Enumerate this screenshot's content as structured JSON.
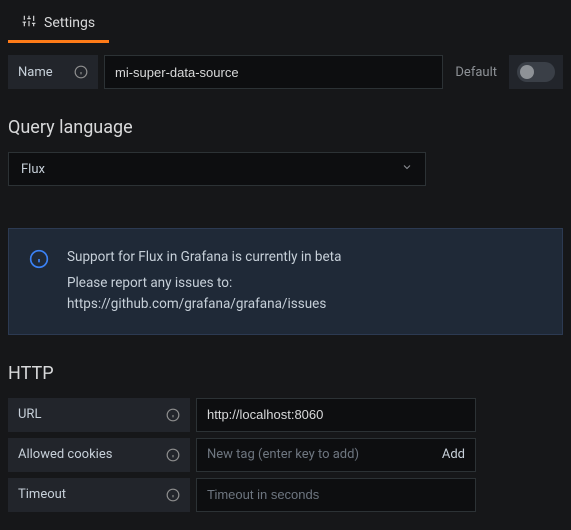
{
  "tab": {
    "label": "Settings"
  },
  "name": {
    "label": "Name",
    "value": "mi-super-data-source"
  },
  "default": {
    "label": "Default"
  },
  "queryLanguage": {
    "title": "Query language",
    "selected": "Flux"
  },
  "infoBox": {
    "title": "Support for Flux in Grafana is currently in beta",
    "line1": "Please report any issues to:",
    "line2": "https://github.com/grafana/grafana/issues"
  },
  "http": {
    "title": "HTTP",
    "url": {
      "label": "URL",
      "value": "http://localhost:8060"
    },
    "cookies": {
      "label": "Allowed cookies",
      "placeholder": "New tag (enter key to add)",
      "addLabel": "Add"
    },
    "timeout": {
      "label": "Timeout",
      "placeholder": "Timeout in seconds"
    }
  }
}
